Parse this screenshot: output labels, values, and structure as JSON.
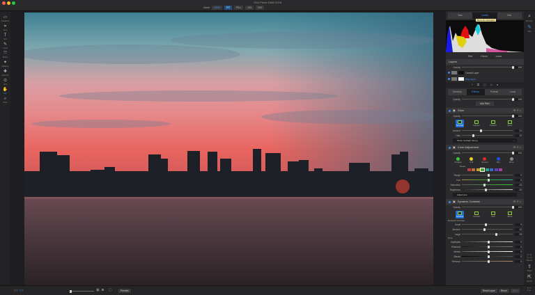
{
  "app": {
    "title": "ON1 Photo RAW 2018"
  },
  "zoom": {
    "label": "Zoom",
    "value": "100%",
    "buttons": [
      "FIT",
      "FILL",
      "100",
      "200"
    ]
  },
  "left_tools": [
    "Transform",
    "Crop",
    "Text",
    "Local",
    "Refine",
    "Masking",
    "Retouch",
    "View",
    "Pan",
    "Zoom"
  ],
  "right_modules_top": [
    {
      "label": "Browse",
      "icon": "browse-icon"
    },
    {
      "label": "Edit",
      "icon": "edit-icon"
    }
  ],
  "right_modules_bottom": [
    {
      "label": "Resize",
      "icon": "resize-icon"
    },
    {
      "label": "Share",
      "icon": "share-icon"
    },
    {
      "label": "Export",
      "icon": "export-icon"
    }
  ],
  "info_tabs": [
    "Nav",
    "Levels",
    "Info"
  ],
  "tooltip": "Show the Navigator",
  "channels": [
    "Red",
    "Colors",
    "Luma"
  ],
  "layers": {
    "title": "Layers",
    "opacity_label": "Opacity",
    "opacity": 100,
    "items": [
      {
        "name": "Overall Layer",
        "active": false
      },
      {
        "name": "Bkg Layer",
        "active": true
      }
    ]
  },
  "edit_tabs": [
    "Develop",
    "Effects",
    "Portrait",
    "Local"
  ],
  "effects": {
    "opacity_label": "Opacity",
    "opacity": 100,
    "add_filter": "Add Filter"
  },
  "glow": {
    "title": "Glow",
    "opacity": 100,
    "modes": [
      "Normal",
      "Lighten",
      "Darken",
      "More"
    ],
    "sliders": [
      {
        "label": "Amount",
        "value": 31,
        "pos": 0.35
      },
      {
        "label": "Halo",
        "value": 12,
        "pos": 0.2
      }
    ],
    "preset": "Mode: Sunlight Strong"
  },
  "color_adjustment": {
    "title": "Color Adjustment",
    "opacity": 100,
    "presets": [
      {
        "label": "Foliage",
        "color": "#3cc43c"
      },
      {
        "label": "Fall",
        "color": "#e8d020"
      },
      {
        "label": "Sunset",
        "color": "#e02828"
      },
      {
        "label": "Sky",
        "color": "#2050e0"
      },
      {
        "label": "More",
        "color": "#888888"
      }
    ],
    "color_label": "Green",
    "swatches": [
      "#c04040",
      "#c07030",
      "#c0a030",
      "#50a030",
      "#30a080",
      "#3070c0",
      "#6040c0",
      "#a040a0"
    ],
    "sliders": [
      {
        "label": "Range",
        "value": 0,
        "pos": 0.5
      },
      {
        "label": "Hue",
        "value": 0,
        "pos": 0.5
      },
      {
        "label": "Saturation",
        "value": -13,
        "pos": 0.42
      },
      {
        "label": "Brightness",
        "value": -10,
        "pos": 0.45
      }
    ],
    "adjust_hue": "Adjust Hue"
  },
  "dynamic_contrast": {
    "title": "Dynamic Contrast",
    "opacity": 100,
    "modes": [
      "Natural",
      "Surreal",
      "Soft",
      "More"
    ],
    "section1": "Dynamic Contrast",
    "sliders1": [
      {
        "label": "Small",
        "value": 9,
        "pos": 0.45
      },
      {
        "label": "Medium",
        "value": 12,
        "pos": 0.42
      },
      {
        "label": "Large",
        "value": 33,
        "pos": 0.66
      }
    ],
    "section2": "Tone",
    "sliders2": [
      {
        "label": "Highlights",
        "value": 0,
        "pos": 0.5
      },
      {
        "label": "Shadows",
        "value": 0,
        "pos": 0.5
      },
      {
        "label": "Whites",
        "value": 0,
        "pos": 0.5
      },
      {
        "label": "Blacks",
        "value": 0,
        "pos": 0.5
      },
      {
        "label": "Vibrance",
        "value": 0,
        "pos": 0.5
      }
    ]
  },
  "bottom": {
    "preview": "Preview",
    "reset_layer": "Reset Layer",
    "reset": "Reset",
    "next": "Next"
  }
}
